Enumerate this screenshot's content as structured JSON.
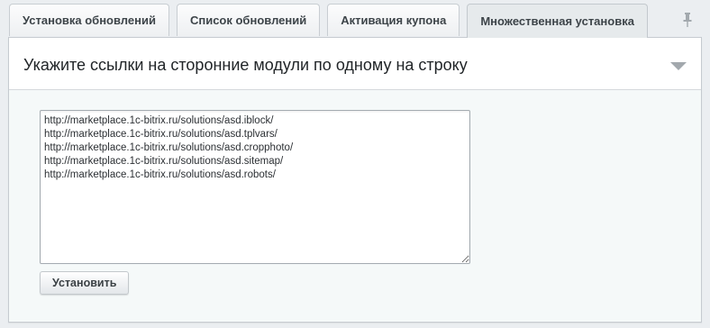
{
  "tabs": [
    {
      "label": "Установка обновлений",
      "active": false
    },
    {
      "label": "Список обновлений",
      "active": false
    },
    {
      "label": "Активация купона",
      "active": false
    },
    {
      "label": "Множественная установка",
      "active": true
    }
  ],
  "pin": {
    "icon": "pin-icon"
  },
  "panel": {
    "title": "Укажите ссылки на сторонние модули по одному на строку",
    "collapse_icon": "triangle-down-icon"
  },
  "form": {
    "links_value": "http://marketplace.1c-bitrix.ru/solutions/asd.iblock/\nhttp://marketplace.1c-bitrix.ru/solutions/asd.tplvars/\nhttp://marketplace.1c-bitrix.ru/solutions/asd.cropphoto/\nhttp://marketplace.1c-bitrix.ru/solutions/asd.sitemap/\nhttp://marketplace.1c-bitrix.ru/solutions/asd.robots/",
    "install_label": "Установить"
  },
  "colors": {
    "page_bg": "#ebeef1",
    "panel_body_bg": "#f5f9f9",
    "tab_text": "#3d4449"
  }
}
